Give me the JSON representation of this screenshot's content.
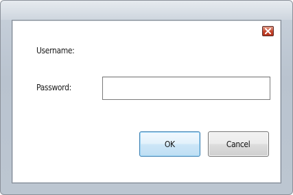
{
  "dialog": {
    "close_symbol": "×",
    "username_label": "Username:",
    "password_label": "Password:",
    "password_value": "",
    "ok_label": "OK",
    "cancel_label": "Cancel"
  },
  "icons": {
    "close": "close-icon"
  },
  "colors": {
    "frame": "#bcc6d1",
    "close_button": "#c5442c",
    "ok_border": "#3c7fb1"
  }
}
